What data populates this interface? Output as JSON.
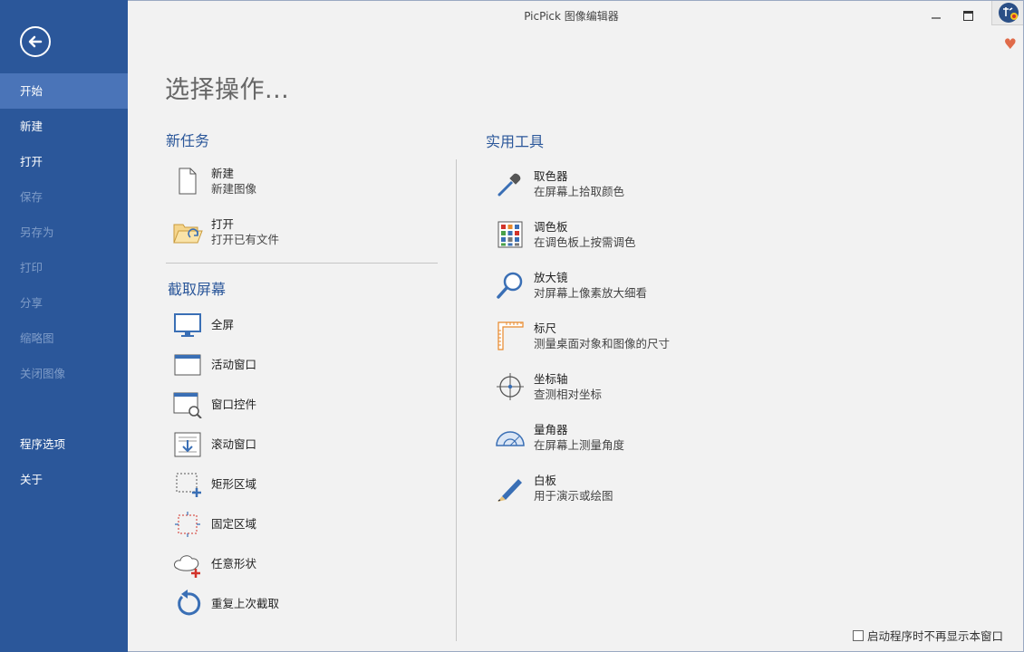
{
  "window": {
    "title": "PicPick 图像编辑器"
  },
  "sidebar": {
    "items": [
      {
        "label": "开始",
        "state": "active"
      },
      {
        "label": "新建",
        "state": "enabled"
      },
      {
        "label": "打开",
        "state": "enabled"
      },
      {
        "label": "保存",
        "state": "disabled"
      },
      {
        "label": "另存为",
        "state": "disabled"
      },
      {
        "label": "打印",
        "state": "disabled"
      },
      {
        "label": "分享",
        "state": "disabled"
      },
      {
        "label": "缩略图",
        "state": "disabled"
      },
      {
        "label": "关闭图像",
        "state": "disabled"
      }
    ],
    "bottom_items": [
      {
        "label": "程序选项"
      },
      {
        "label": "关于"
      }
    ]
  },
  "main": {
    "heading": "选择操作...",
    "new_task": {
      "title": "新任务",
      "items": [
        {
          "title": "新建",
          "desc": "新建图像",
          "icon": "new-file-icon"
        },
        {
          "title": "打开",
          "desc": "打开已有文件",
          "icon": "open-folder-icon"
        }
      ]
    },
    "capture": {
      "title": "截取屏幕",
      "items": [
        {
          "title": "全屏",
          "icon": "monitor-icon"
        },
        {
          "title": "活动窗口",
          "icon": "window-icon"
        },
        {
          "title": "窗口控件",
          "icon": "window-control-icon"
        },
        {
          "title": "滚动窗口",
          "icon": "scroll-window-icon"
        },
        {
          "title": "矩形区域",
          "icon": "rect-region-icon"
        },
        {
          "title": "固定区域",
          "icon": "fixed-region-icon"
        },
        {
          "title": "任意形状",
          "icon": "freehand-shape-icon"
        },
        {
          "title": "重复上次截取",
          "icon": "repeat-icon"
        }
      ]
    },
    "tools": {
      "title": "实用工具",
      "items": [
        {
          "title": "取色器",
          "desc": "在屏幕上拾取颜色",
          "icon": "eyedropper-icon"
        },
        {
          "title": "调色板",
          "desc": "在调色板上按需调色",
          "icon": "palette-icon"
        },
        {
          "title": "放大镜",
          "desc": "对屏幕上像素放大细看",
          "icon": "magnifier-icon"
        },
        {
          "title": "标尺",
          "desc": "测量桌面对象和图像的尺寸",
          "icon": "ruler-icon"
        },
        {
          "title": "坐标轴",
          "desc": "查测相对坐标",
          "icon": "crosshair-icon"
        },
        {
          "title": "量角器",
          "desc": "在屏幕上测量角度",
          "icon": "protractor-icon"
        },
        {
          "title": "白板",
          "desc": "用于演示或绘图",
          "icon": "pen-icon"
        }
      ]
    }
  },
  "footer": {
    "checkbox_label": "启动程序时不再显示本窗口",
    "checked": false
  },
  "colors": {
    "sidebar_bg": "#2b579a",
    "sidebar_active": "#4a74b8",
    "accent": "#2b579a",
    "heart": "#e06b4a"
  }
}
